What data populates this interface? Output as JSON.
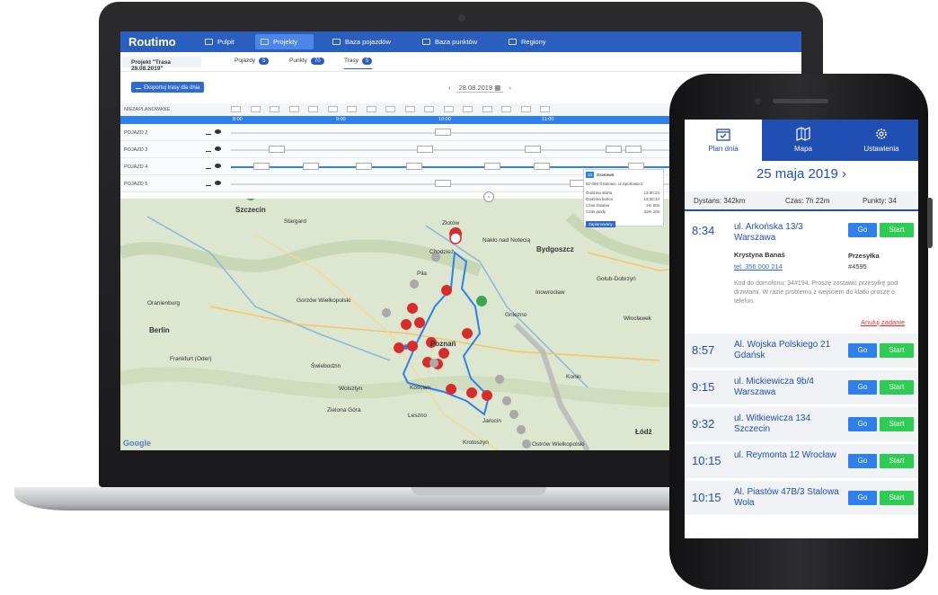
{
  "web": {
    "logo": "Routimo",
    "nav": [
      "Pulpit",
      "Projekty",
      "Baza pojazdów",
      "Baza punktów",
      "Regiony"
    ],
    "project": "Projekt \"Trasa 28.08.2019\"",
    "tabs": [
      {
        "label": "Pojazdy",
        "count": "5"
      },
      {
        "label": "Punkty",
        "count": "70"
      },
      {
        "label": "Trasy",
        "count": "5"
      }
    ],
    "export_label": "Eksportuj trasy dla dnia",
    "date": "28.08.2019",
    "unplanned_label": "NIEZAPLANOWANE",
    "hours": [
      "8:00",
      "9:00",
      "10:00",
      "11:00"
    ],
    "vehicles": [
      "POJAZD 2",
      "POJAZD 3",
      "POJAZD 4",
      "POJAZD 5"
    ],
    "popup": {
      "number": "10",
      "name": "Granowo",
      "address": "62-066 Granowo, ul.Sportowa 2",
      "rows": [
        {
          "k": "Godzina startu",
          "v": "13:30:24"
        },
        {
          "k": "Godzina końca",
          "v": "13:32:24"
        },
        {
          "k": "Czas trwania",
          "v": "2m 00s"
        },
        {
          "k": "Czas jazdy",
          "v": "22m 10s"
        }
      ],
      "status": "Zaplanowany"
    },
    "map_cities": [
      "Szczecin",
      "Stargard",
      "Złotów",
      "Nakło nad Notecią",
      "Bydgoszcz",
      "Chodzież",
      "Piła",
      "Gorzów Wielkopolski",
      "Berlin",
      "Poznań",
      "Świebodzin",
      "Wolsztyn",
      "Kościan",
      "Leszno",
      "Zielona Góra",
      "Jarocin",
      "Krotoszyn",
      "Łódź",
      "Włocławek",
      "Inowrocław",
      "Gniezno",
      "Konin",
      "Frankfurt (Oder)",
      "Oranienburg",
      "Ostrów Wielkopolski",
      "Golub-Dobrzyń"
    ],
    "google": "Google"
  },
  "mobile": {
    "tabs": [
      "Plan dnia",
      "Mapa",
      "Ustawienia"
    ],
    "date": "25 maja 2019",
    "date_arrow": "›",
    "stats": {
      "distance": "Dystans: 342km",
      "time": "Czas: 7h 22m",
      "points": "Punkty: 34"
    },
    "stops": [
      {
        "time": "8:34",
        "address": "ul. Arkońska 13/3 Warszawa"
      },
      {
        "time": "8:57",
        "address": "Al. Wojska Polskiego 21 Gdańsk"
      },
      {
        "time": "9:15",
        "address": "ul. Mickiewicza 9b/4 Warszawa"
      },
      {
        "time": "9:32",
        "address": "ul. Witkiewicza 134 Szczecin"
      },
      {
        "time": "10:15",
        "address": "ul. Reymonta 12 Wrocław"
      },
      {
        "time": "10:15",
        "address": "Al. Piastów 47B/3 Stalowa Wola"
      }
    ],
    "details": {
      "name": "Krystyna Banaś",
      "phone": "tel. 356 000 214",
      "parcel_label": "Przesyłka",
      "parcel_id": "#4595",
      "note": "Kod do domofonu: 34#194. Proszę zostawić przesyłkę pod drzwiami. W razie problemu z wejściem do klatki proszę o telefon.",
      "cancel": "Anuluj zadanie"
    },
    "go_label": "Go",
    "start_label": "Start"
  }
}
